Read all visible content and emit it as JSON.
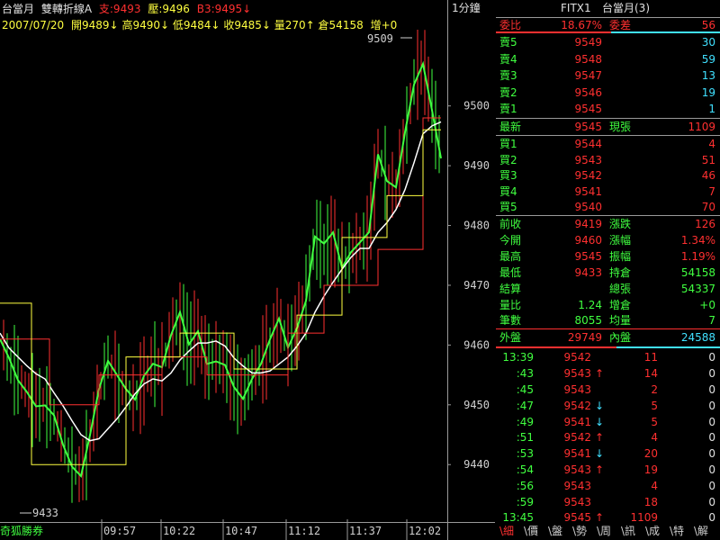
{
  "header": {
    "instrument": "台當月",
    "indicator": "雙轉折線A",
    "support_label": "支:9493",
    "resistance_label": "壓:9496",
    "b3_label": "B3:9495↓",
    "date": "2007/07/20",
    "open": "開9489↓",
    "high": "高9490↓",
    "low": "低9484↓",
    "close": "收9485↓",
    "volume": "量270↑",
    "oi": "倉54158",
    "more": "增+0"
  },
  "chart_data": {
    "type": "line",
    "y_ticks": [
      9440,
      9450,
      9460,
      9470,
      9480,
      9490,
      9500
    ],
    "y_tick_labels": [
      "9440",
      "9450",
      "9460",
      "9470",
      "9480",
      "9490",
      "9500"
    ],
    "ylim": [
      9431,
      9512
    ],
    "x_tick_labels": [
      "09:57",
      "10:22",
      "10:47",
      "11:12",
      "11:37",
      "12:02"
    ],
    "high_label": "9509",
    "low_label": "9433",
    "colors": {
      "red": "#ff3030",
      "green": "#40ff40",
      "yellow": "#ffff40",
      "white": "#ffffff"
    }
  },
  "quote": {
    "title_code": "FITX1",
    "title_name": "台當月(3)",
    "ratio_label": "委比",
    "ratio_value": "18.67%",
    "diff_label": "委差",
    "diff_value": "56",
    "asks": [
      {
        "label": "賣5",
        "price": "9549",
        "qty": "30"
      },
      {
        "label": "賣4",
        "price": "9548",
        "qty": "59"
      },
      {
        "label": "賣3",
        "price": "9547",
        "qty": "13"
      },
      {
        "label": "賣2",
        "price": "9546",
        "qty": "19"
      },
      {
        "label": "賣1",
        "price": "9545",
        "qty": "1"
      }
    ],
    "last_label": "最新",
    "last_value": "9545",
    "cur_label": "現張",
    "cur_value": "1109",
    "bids": [
      {
        "label": "買1",
        "price": "9544",
        "qty": "4"
      },
      {
        "label": "買2",
        "price": "9543",
        "qty": "51"
      },
      {
        "label": "買3",
        "price": "9542",
        "qty": "46"
      },
      {
        "label": "買4",
        "price": "9541",
        "qty": "7"
      },
      {
        "label": "買5",
        "price": "9540",
        "qty": "70"
      }
    ],
    "stats": [
      {
        "l1": "前收",
        "v1": "9419",
        "l2": "漲跌",
        "v2": "126"
      },
      {
        "l1": "今開",
        "v1": "9460",
        "l2": "漲幅",
        "v2": "1.34%"
      },
      {
        "l1": "最高",
        "v1": "9545",
        "l2": "振幅",
        "v2": "1.19%"
      },
      {
        "l1": "最低",
        "v1": "9433",
        "l2": "持倉",
        "v2": "54158"
      },
      {
        "l1": "結算",
        "v1": "",
        "l2": "總張",
        "v2": "54337"
      },
      {
        "l1": "量比",
        "v1": "1.24",
        "l2": "增倉",
        "v2": "+0"
      },
      {
        "l1": "筆數",
        "v1": "8055",
        "l2": "均量",
        "v2": "7"
      }
    ],
    "outer_label": "外盤",
    "outer_value": "29749",
    "inner_label": "內盤",
    "inner_value": "24588",
    "ticks": [
      {
        "time": "13:39",
        "price": "9542",
        "arrow": "",
        "qty": "11",
        "z": "0"
      },
      {
        "time": ":43",
        "price": "9543",
        "arrow": "↑",
        "qty": "14",
        "z": "0"
      },
      {
        "time": ":45",
        "price": "9543",
        "arrow": "",
        "qty": "2",
        "z": "0"
      },
      {
        "time": ":47",
        "price": "9542",
        "arrow": "↓",
        "qty": "5",
        "z": "0"
      },
      {
        "time": ":49",
        "price": "9541",
        "arrow": "↓",
        "qty": "5",
        "z": "0"
      },
      {
        "time": ":51",
        "price": "9542",
        "arrow": "↑",
        "qty": "4",
        "z": "0"
      },
      {
        "time": ":53",
        "price": "9541",
        "arrow": "↓",
        "qty": "20",
        "z": "0"
      },
      {
        "time": ":54",
        "price": "9543",
        "arrow": "↑",
        "qty": "19",
        "z": "0"
      },
      {
        "time": ":56",
        "price": "9543",
        "arrow": "",
        "qty": "4",
        "z": "0"
      },
      {
        "time": ":59",
        "price": "9543",
        "arrow": "",
        "qty": "18",
        "z": "0"
      },
      {
        "time": "13:45",
        "price": "9545",
        "arrow": "↑",
        "qty": "1109",
        "z": "0"
      }
    ]
  },
  "footer": {
    "broker": "奇狐勝券",
    "period": "1分鐘",
    "tabs": [
      "細",
      "價",
      "盤",
      "勢",
      "周",
      "訊",
      "成",
      "特",
      "解"
    ]
  }
}
